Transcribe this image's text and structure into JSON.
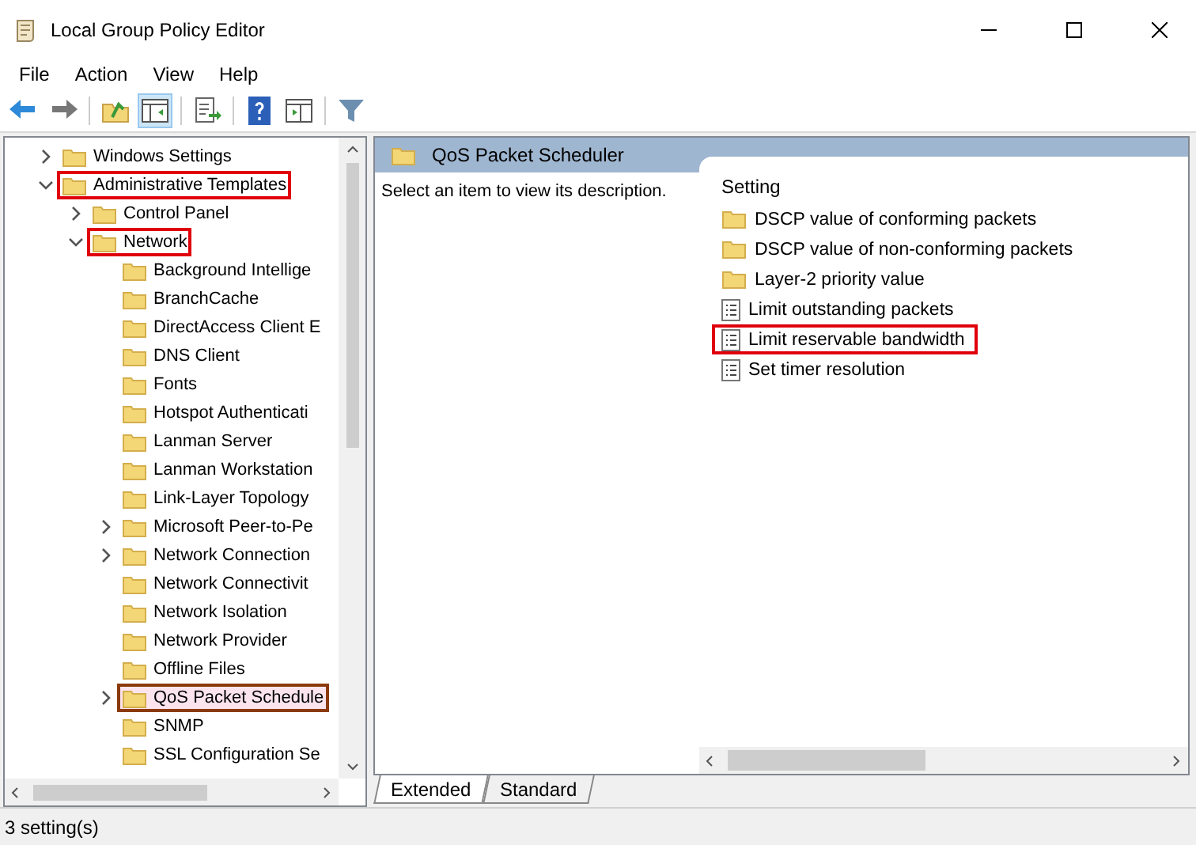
{
  "window": {
    "title": "Local Group Policy Editor"
  },
  "menu": [
    "File",
    "Action",
    "View",
    "Help"
  ],
  "toolbar": [
    {
      "kind": "back",
      "selected": false
    },
    {
      "kind": "forward",
      "selected": false
    },
    {
      "kind": "sep",
      "selected": false
    },
    {
      "kind": "up",
      "selected": false
    },
    {
      "kind": "tree",
      "selected": true
    },
    {
      "kind": "sep",
      "selected": false
    },
    {
      "kind": "export",
      "selected": false
    },
    {
      "kind": "sep",
      "selected": false
    },
    {
      "kind": "help",
      "selected": false
    },
    {
      "kind": "pane",
      "selected": false
    },
    {
      "kind": "sep",
      "selected": false
    },
    {
      "kind": "filter",
      "selected": false
    }
  ],
  "tree": [
    {
      "label": "Windows Settings",
      "expandable": true,
      "expanded": false,
      "selected": false,
      "highlighted": false
    },
    {
      "label": "Administrative Templates",
      "expandable": true,
      "expanded": true,
      "selected": false,
      "highlighted": true,
      "children": [
        {
          "label": "Control Panel",
          "expandable": true,
          "expanded": false,
          "selected": false,
          "highlighted": false
        },
        {
          "label": "Network",
          "expandable": true,
          "expanded": true,
          "selected": false,
          "highlighted": true,
          "children": [
            {
              "label": "Background Intellige",
              "expandable": false,
              "expanded": false,
              "selected": false,
              "highlighted": false
            },
            {
              "label": "BranchCache",
              "expandable": false,
              "expanded": false,
              "selected": false,
              "highlighted": false
            },
            {
              "label": "DirectAccess Client E",
              "expandable": false,
              "expanded": false,
              "selected": false,
              "highlighted": false
            },
            {
              "label": "DNS Client",
              "expandable": false,
              "expanded": false,
              "selected": false,
              "highlighted": false
            },
            {
              "label": "Fonts",
              "expandable": false,
              "expanded": false,
              "selected": false,
              "highlighted": false
            },
            {
              "label": "Hotspot Authenticati",
              "expandable": false,
              "expanded": false,
              "selected": false,
              "highlighted": false
            },
            {
              "label": "Lanman Server",
              "expandable": false,
              "expanded": false,
              "selected": false,
              "highlighted": false
            },
            {
              "label": "Lanman Workstation",
              "expandable": false,
              "expanded": false,
              "selected": false,
              "highlighted": false
            },
            {
              "label": "Link-Layer Topology",
              "expandable": false,
              "expanded": false,
              "selected": false,
              "highlighted": false
            },
            {
              "label": "Microsoft Peer-to-Pe",
              "expandable": true,
              "expanded": false,
              "selected": false,
              "highlighted": false
            },
            {
              "label": "Network Connection",
              "expandable": true,
              "expanded": false,
              "selected": false,
              "highlighted": false
            },
            {
              "label": "Network Connectivit",
              "expandable": false,
              "expanded": false,
              "selected": false,
              "highlighted": false
            },
            {
              "label": "Network Isolation",
              "expandable": false,
              "expanded": false,
              "selected": false,
              "highlighted": false
            },
            {
              "label": "Network Provider",
              "expandable": false,
              "expanded": false,
              "selected": false,
              "highlighted": false
            },
            {
              "label": "Offline Files",
              "expandable": false,
              "expanded": false,
              "selected": false,
              "highlighted": false
            },
            {
              "label": "QoS Packet Schedule",
              "expandable": true,
              "expanded": false,
              "selected": true,
              "highlighted": false
            },
            {
              "label": "SNMP",
              "expandable": false,
              "expanded": false,
              "selected": false,
              "highlighted": false
            },
            {
              "label": "SSL Configuration Se",
              "expandable": false,
              "expanded": false,
              "selected": false,
              "highlighted": false
            }
          ]
        }
      ]
    }
  ],
  "details": {
    "title": "QoS Packet Scheduler",
    "description": "Select an item to view its description.",
    "column": "Setting",
    "settings": [
      {
        "kind": "folder",
        "label": "DSCP value of conforming packets",
        "highlighted": false
      },
      {
        "kind": "folder",
        "label": "DSCP value of non-conforming packets",
        "highlighted": false
      },
      {
        "kind": "folder",
        "label": "Layer-2 priority value",
        "highlighted": false
      },
      {
        "kind": "policy",
        "label": "Limit outstanding packets",
        "highlighted": false
      },
      {
        "kind": "policy",
        "label": "Limit reservable bandwidth",
        "highlighted": true
      },
      {
        "kind": "policy",
        "label": "Set timer resolution",
        "highlighted": false
      }
    ]
  },
  "tabs": [
    {
      "label": "Extended",
      "selected": true
    },
    {
      "label": "Standard",
      "selected": false
    }
  ],
  "status_bar": "3 setting(s)"
}
